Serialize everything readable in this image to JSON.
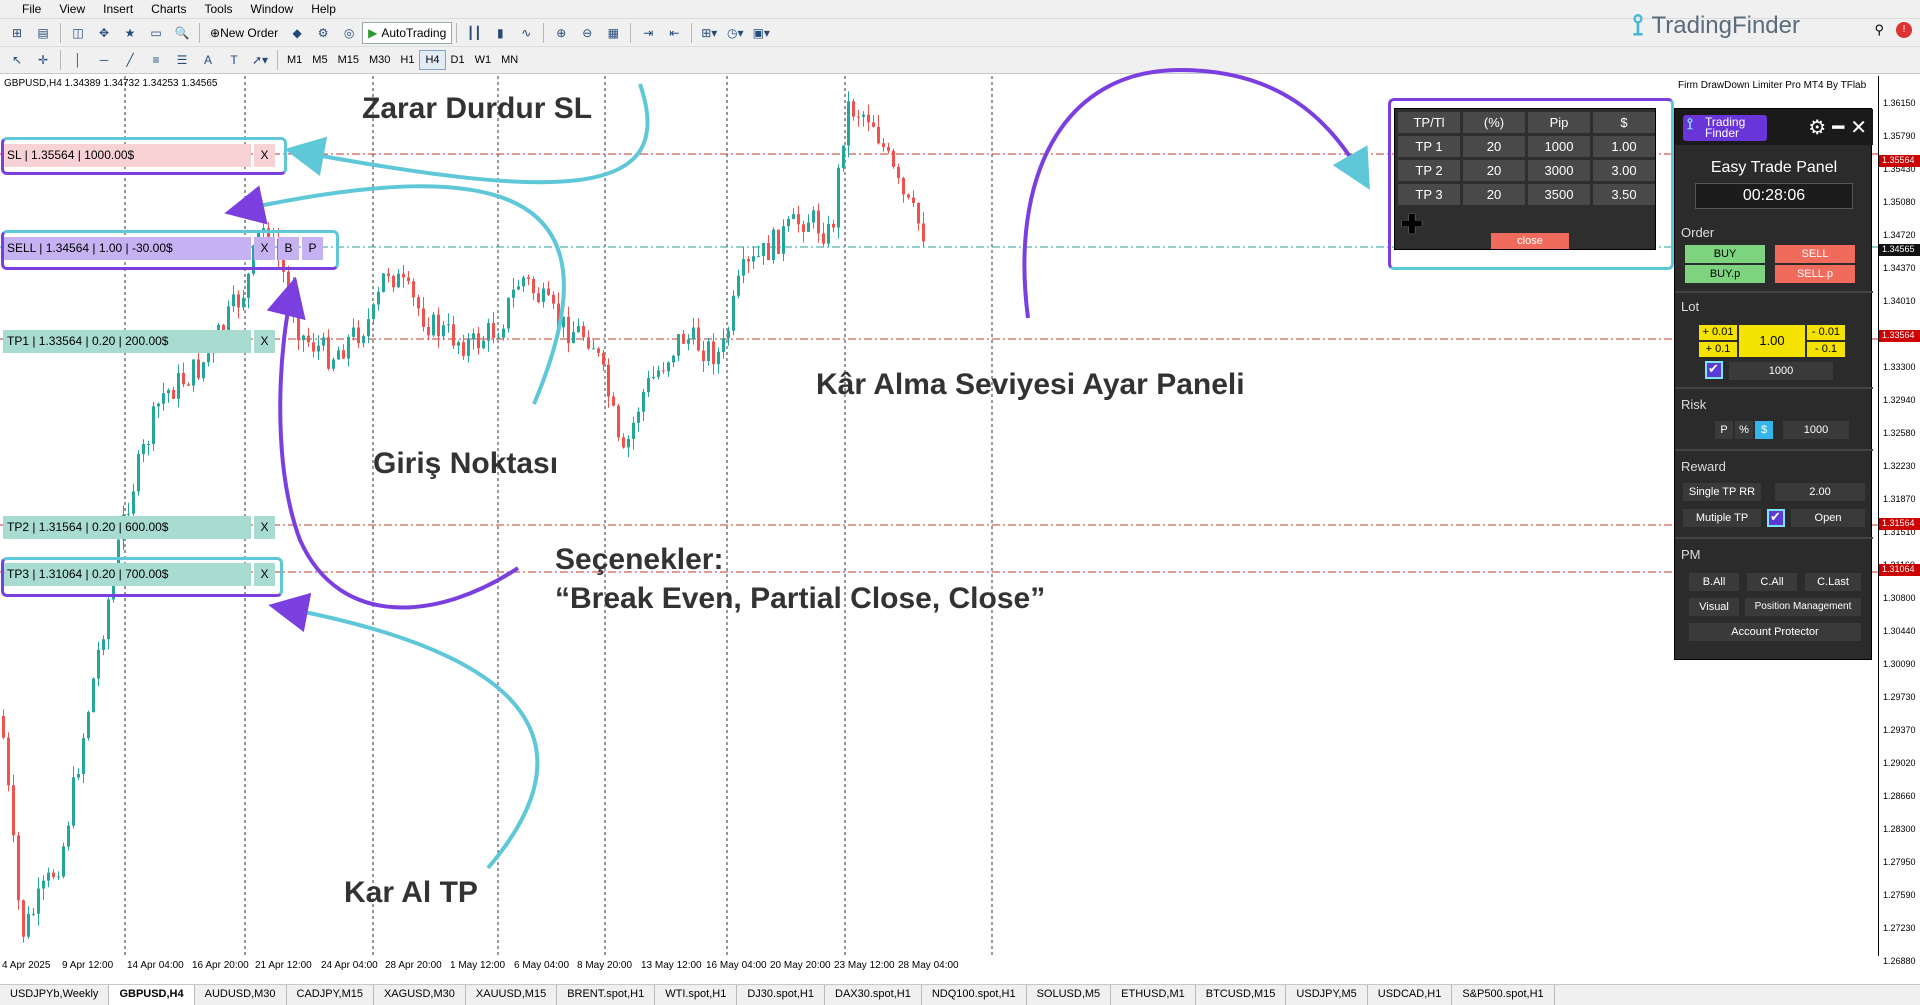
{
  "menu": [
    "File",
    "View",
    "Insert",
    "Charts",
    "Tools",
    "Window",
    "Help"
  ],
  "toolbar": {
    "new_order": "New Order",
    "auto_trading": "AutoTrading",
    "timeframes": [
      "M1",
      "M5",
      "M15",
      "M30",
      "H1",
      "H4",
      "D1",
      "W1",
      "MN"
    ],
    "active_timeframe": "H4"
  },
  "brand": {
    "name": "TradingFinder",
    "logo": "tf-logo-icon"
  },
  "chart": {
    "symbol_info": "GBPUSD,H4  1.34389 1.34732 1.34253 1.34565",
    "ea_title": "Firm DrawDown Limiter Pro MT4 By TFlab",
    "price_labels": [
      "1.36150",
      "1.35790",
      "1.35430",
      "1.35080",
      "1.34720",
      "1.34370",
      "1.34010",
      "1.33660",
      "1.33300",
      "1.32940",
      "1.32580",
      "1.32230",
      "1.31870",
      "1.31510",
      "1.31160",
      "1.30800",
      "1.30440",
      "1.30090",
      "1.29730",
      "1.29370",
      "1.29020",
      "1.28660",
      "1.28300",
      "1.27950",
      "1.27590",
      "1.27230",
      "1.26880"
    ],
    "price_tags": {
      "sl": "1.35564",
      "current": "1.34565",
      "tp1": "1.33564",
      "tp2": "1.31564",
      "tp3": "1.31064"
    },
    "time_labels": [
      "4 Apr 2025",
      "9 Apr 12:00",
      "14 Apr 04:00",
      "16 Apr 20:00",
      "21 Apr 12:00",
      "24 Apr 04:00",
      "28 Apr 20:00",
      "1 May 12:00",
      "6 May 04:00",
      "8 May 20:00",
      "13 May 12:00",
      "16 May 04:00",
      "20 May 20:00",
      "23 May 12:00",
      "28 May 04:00"
    ]
  },
  "trade_lines": {
    "sl": {
      "label": "SL | 1.35564 | 1000.00$",
      "close": "X"
    },
    "sell": {
      "label": "SELL | 1.34564 | 1.00 | -30.00$",
      "close": "X",
      "be": "B",
      "partial": "P"
    },
    "tp1": {
      "label": "TP1 | 1.33564 | 0.20 | 200.00$",
      "close": "X"
    },
    "tp2": {
      "label": "TP2 | 1.31564 | 0.20 | 600.00$",
      "close": "X"
    },
    "tp3": {
      "label": "TP3 | 1.31064 | 0.20 | 700.00$",
      "close": "X"
    }
  },
  "annotations": {
    "sl": "Zarar Durdur SL",
    "entry": "Giriş Noktası",
    "options_1": "Seçenekler:",
    "options_2": "“Break Even, Partial Close, Close”",
    "tp": "Kar Al TP",
    "tp_panel": "Kâr Alma Seviyesi Ayar Paneli"
  },
  "tp_table": {
    "headers": [
      "TP/Tl",
      "(%)",
      "Pip",
      "$"
    ],
    "rows": [
      [
        "TP 1",
        "20",
        "1000",
        "1.00"
      ],
      [
        "TP 2",
        "20",
        "3000",
        "3.00"
      ],
      [
        "TP 3",
        "20",
        "3500",
        "3.50"
      ]
    ],
    "add": "✚",
    "close": "close"
  },
  "panel": {
    "logo_line1": "Trading",
    "logo_line2": "Finder",
    "title": "Easy Trade Panel",
    "timer": "00:28:06",
    "order": {
      "label": "Order",
      "buy": "BUY",
      "sell": "SELL",
      "buy_p": "BUY.p",
      "sell_p": "SELL.p"
    },
    "lot": {
      "label": "Lot",
      "plus001": "+ 0.01",
      "plus01": "+ 0.1",
      "value": "1.00",
      "minus001": "- 0.01",
      "minus01": "- 0.1",
      "amount": "1000"
    },
    "risk": {
      "label": "Risk",
      "p": "P",
      "pct": "%",
      "usd": "$",
      "value": "1000"
    },
    "reward": {
      "label": "Reward",
      "single": "Single TP RR",
      "rr": "2.00",
      "multiple": "Mutiple TP",
      "open": "Open"
    },
    "pm": {
      "label": "PM",
      "b_all": "B.All",
      "c_all": "C.All",
      "c_last": "C.Last",
      "visual": "Visual",
      "position": "Position Management",
      "protector": "Account Protector"
    }
  },
  "tabs": [
    "USDJPYb,Weekly",
    "GBPUSD,H4",
    "AUDUSD,M30",
    "CADJPY,M15",
    "XAGUSD,M30",
    "XAUUSD,M15",
    "BRENT.spot,H1",
    "WTI.spot,H1",
    "DJ30.spot,H1",
    "DAX30.spot,H1",
    "NDQ100.spot,H1",
    "SOLUSD,M5",
    "ETHUSD,M1",
    "BTCUSD,M15",
    "USDJPY,M5",
    "USDCAD,H1",
    "S&P500.spot,H1"
  ],
  "active_tab": "GBPUSD,H4",
  "colors": {
    "sl": "#f9d2d6",
    "sell": "#c6b2f3",
    "tp": "#a8dcd0",
    "bull": "#26a69a",
    "bear": "#ef5350",
    "accent_cyan": "#5fc8d8",
    "accent_purple": "#7b3fe0"
  }
}
